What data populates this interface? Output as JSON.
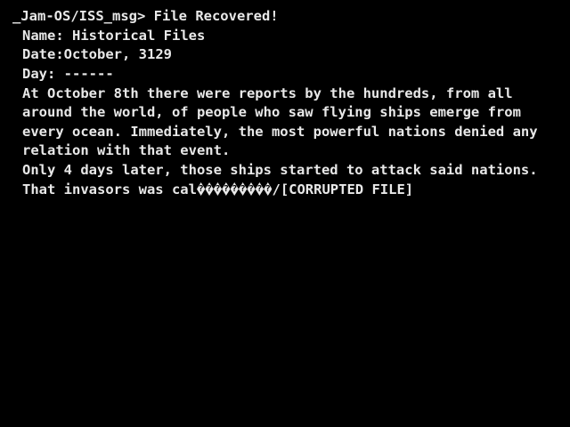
{
  "terminal": {
    "prompt": "_Jam-OS/ISS_msg>",
    "command_output": "File Recovered!",
    "fields": {
      "name_label": "Name:",
      "name_value": "Historical Files",
      "date_label": "Date:",
      "date_value": "October, 3129",
      "day_label": "Day:",
      "day_value": "------"
    },
    "body_lines": [
      "At October 8th there were reports by the hundreds, from all",
      "around the world, of people who saw flying ships emerge from",
      "every ocean. Immediately, the most powerful nations denied any",
      "relation with that event.",
      "Only 4 days later, those ships started to attack said nations."
    ],
    "last_line_prefix": "That invasors was cal",
    "corrupted_glyph_count": 9,
    "last_line_suffix": "/[CORRUPTED FILE]"
  }
}
